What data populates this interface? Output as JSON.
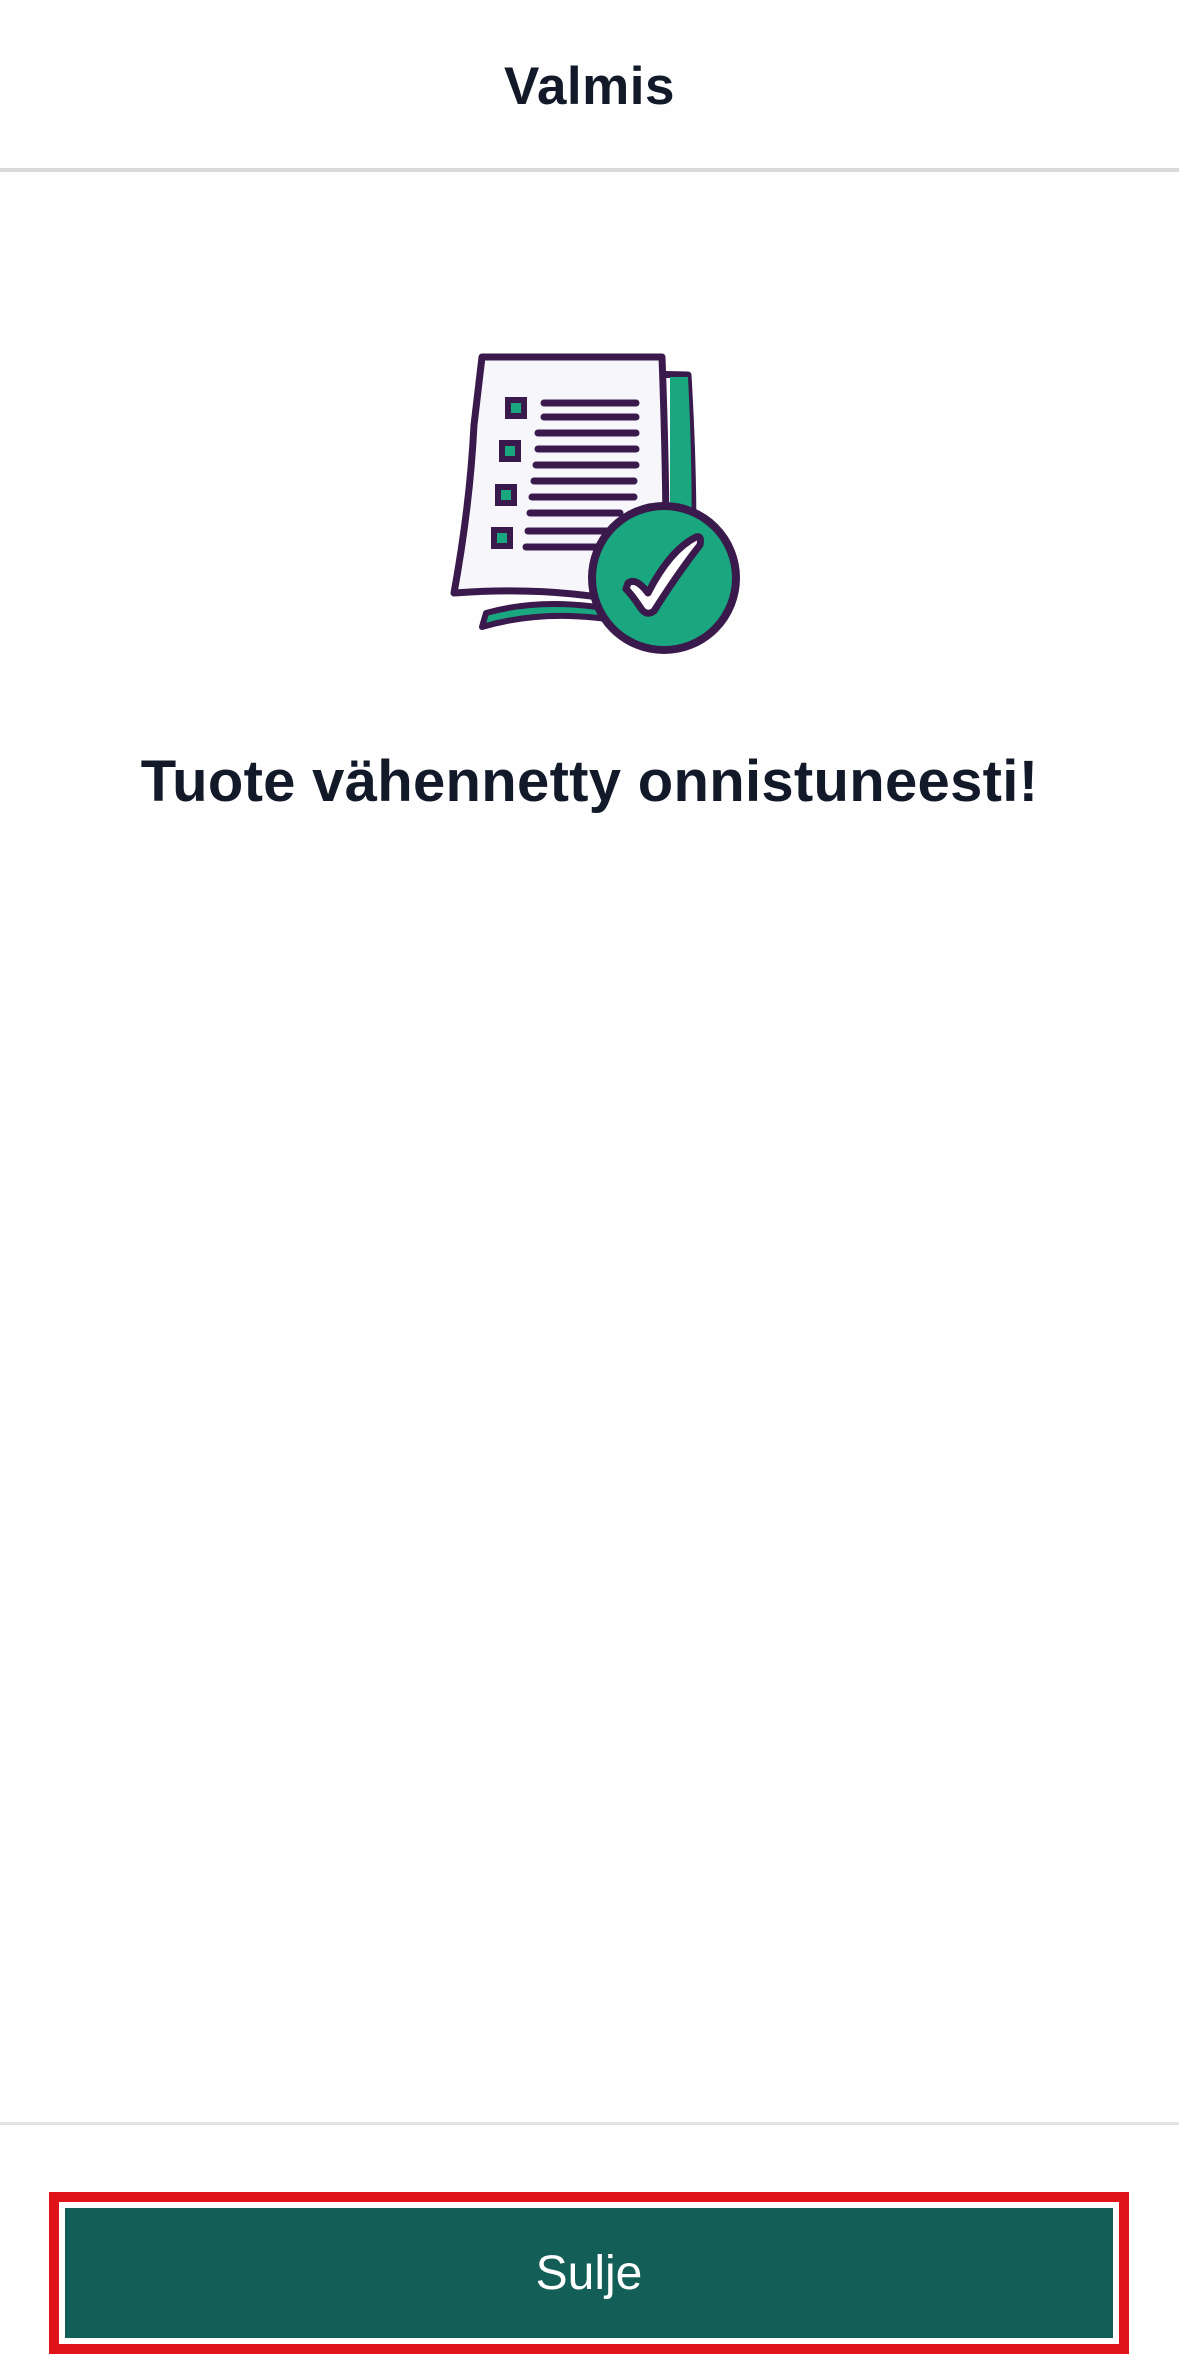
{
  "header": {
    "title": "Valmis"
  },
  "main": {
    "illustration_icon": "checklist-document-check-icon",
    "message": "Tuote vähennetty onnistuneesti!"
  },
  "footer": {
    "close_label": "Sulje"
  },
  "colors": {
    "primary": "#135e57",
    "accent_green": "#1aa67e",
    "icon_outline": "#3a1a4c",
    "text_dark": "#121a2a",
    "highlight_red": "#e0131b"
  }
}
